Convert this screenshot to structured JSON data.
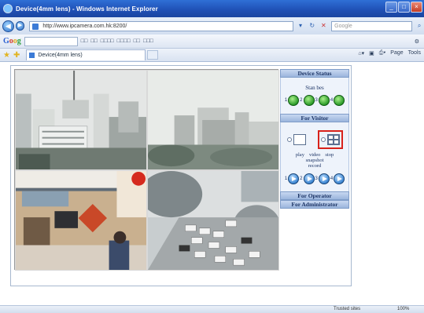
{
  "window": {
    "title": "Device(4mm lens) - Windows Internet Explorer"
  },
  "address_bar": {
    "url": "http://www.ipcamera.com.hk:8200/",
    "search_placeholder": "Google"
  },
  "google_toolbar": {
    "logo": [
      "G",
      "o",
      "o",
      "g"
    ],
    "items": [
      "□□",
      "□□",
      "□□□□",
      "□□□□",
      "□□",
      "□□□"
    ]
  },
  "tabs": [
    {
      "label": "Device(4mm lens)"
    }
  ],
  "command_bar": {
    "page": "Page",
    "tools": "Tools"
  },
  "panel": {
    "device_status": {
      "header": "Device Status",
      "alarm_label": "Stan bes",
      "channels": [
        "1",
        "2",
        "3",
        "4"
      ]
    },
    "for_visitor": {
      "header": "For Visitor",
      "labels_row1": [
        "play",
        "video",
        "stop"
      ],
      "label_snapshot": "snapshot",
      "label_record": "record",
      "ptz_channels": [
        "1",
        "2",
        "3",
        "4"
      ],
      "selected_view": "quad"
    },
    "for_operator": {
      "header": "For Operator"
    },
    "for_administrator": {
      "header": "For Administrator"
    }
  },
  "statusbar": {
    "zone": "Trusted sites",
    "zoom": "100%"
  }
}
